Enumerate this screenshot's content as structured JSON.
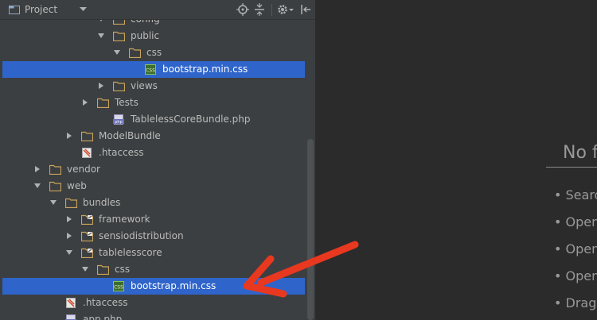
{
  "toolbar": {
    "title": "Project",
    "icons": [
      "project-folder-icon",
      "chevron-down-icon",
      "locate-icon",
      "collapse-icon",
      "gear-icon",
      "hide-icon"
    ]
  },
  "tree": [
    {
      "label": "config",
      "indent": 5,
      "expanded": true,
      "kind": "folder"
    },
    {
      "label": "public",
      "indent": 5,
      "expanded": true,
      "kind": "folder"
    },
    {
      "label": "css",
      "indent": 6,
      "expanded": true,
      "kind": "folder"
    },
    {
      "label": "bootstrap.min.css",
      "indent": 7,
      "expanded": null,
      "kind": "css",
      "selected": true
    },
    {
      "label": "views",
      "indent": 5,
      "expanded": false,
      "kind": "folder"
    },
    {
      "label": "Tests",
      "indent": 4,
      "expanded": false,
      "kind": "folder"
    },
    {
      "label": "TablelessCoreBundle.php",
      "indent": 5,
      "expanded": null,
      "kind": "php"
    },
    {
      "label": "ModelBundle",
      "indent": 3,
      "expanded": false,
      "kind": "folder"
    },
    {
      "label": ".htaccess",
      "indent": 3,
      "expanded": null,
      "kind": "htaccess"
    },
    {
      "label": "vendor",
      "indent": 1,
      "expanded": false,
      "kind": "folder"
    },
    {
      "label": "web",
      "indent": 1,
      "expanded": true,
      "kind": "folder"
    },
    {
      "label": "bundles",
      "indent": 2,
      "expanded": true,
      "kind": "folder"
    },
    {
      "label": "framework",
      "indent": 3,
      "expanded": false,
      "kind": "linkfolder"
    },
    {
      "label": "sensiodistribution",
      "indent": 3,
      "expanded": false,
      "kind": "linkfolder"
    },
    {
      "label": "tablelesscore",
      "indent": 3,
      "expanded": true,
      "kind": "linkfolder"
    },
    {
      "label": "css",
      "indent": 4,
      "expanded": true,
      "kind": "folder"
    },
    {
      "label": "bootstrap.min.css",
      "indent": 5,
      "expanded": null,
      "kind": "css",
      "selected": true
    },
    {
      "label": ".htaccess",
      "indent": 2,
      "expanded": null,
      "kind": "htaccess"
    },
    {
      "label": "app.php",
      "indent": 2,
      "expanded": null,
      "kind": "php"
    }
  ],
  "editor": {
    "empty_title": "No f",
    "hints": [
      "• Searc",
      "• Open",
      "• Open",
      "• Open",
      "• Drag"
    ]
  },
  "colors": {
    "selection": "#2f65ca",
    "folder": "#c9a35a",
    "arrow_annotation": "#e8381f"
  }
}
